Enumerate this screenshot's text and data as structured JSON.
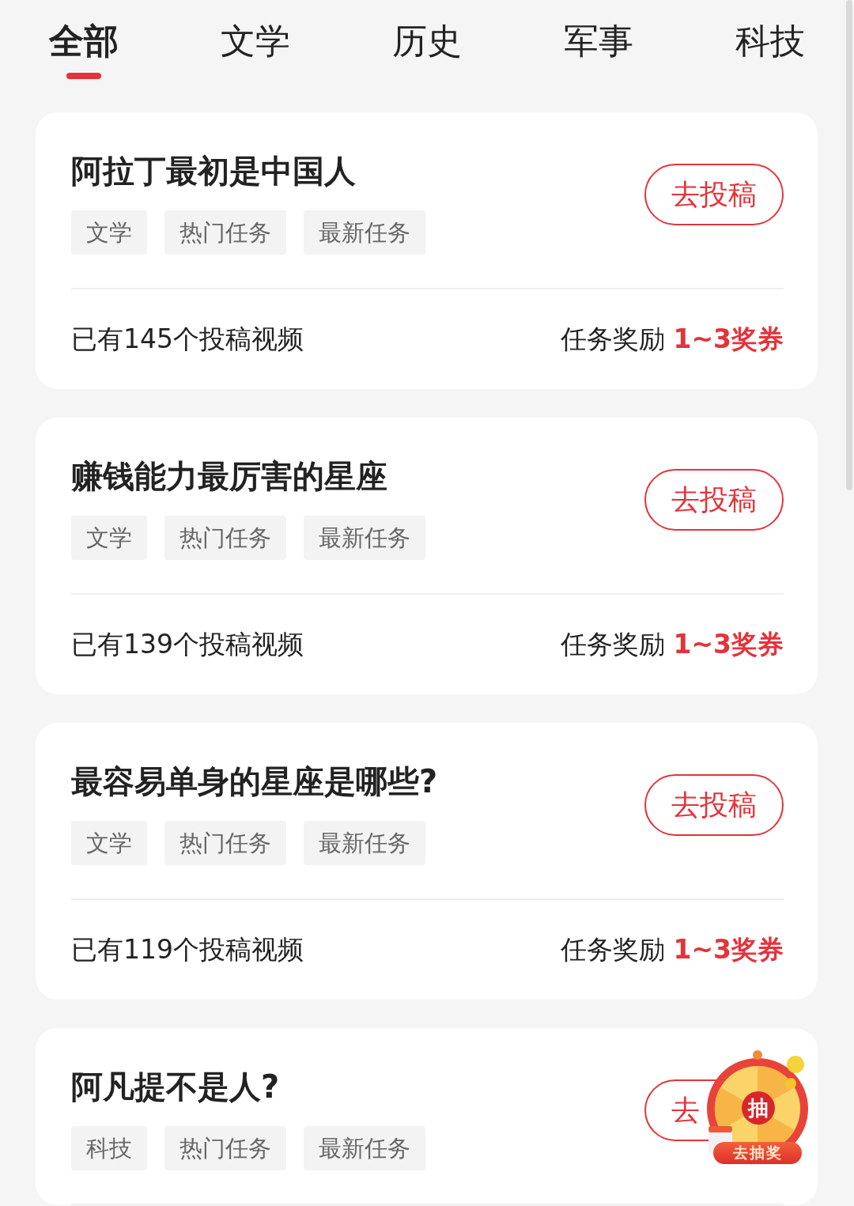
{
  "tabs": [
    {
      "label": "全部",
      "selected": true
    },
    {
      "label": "文学",
      "selected": false
    },
    {
      "label": "历史",
      "selected": false
    },
    {
      "label": "军事",
      "selected": false
    },
    {
      "label": "科技",
      "selected": false
    }
  ],
  "tasks": [
    {
      "title": "阿拉丁最初是中国人",
      "tags": [
        "文学",
        "热门任务",
        "最新任务"
      ],
      "button": "去投稿",
      "count": "已有145个投稿视频",
      "reward_label": "任务奖励",
      "reward_value": "1~3奖券"
    },
    {
      "title": "赚钱能力最厉害的星座",
      "tags": [
        "文学",
        "热门任务",
        "最新任务"
      ],
      "button": "去投稿",
      "count": "已有139个投稿视频",
      "reward_label": "任务奖励",
      "reward_value": "1~3奖券"
    },
    {
      "title": "最容易单身的星座是哪些?",
      "tags": [
        "文学",
        "热门任务",
        "最新任务"
      ],
      "button": "去投稿",
      "count": "已有119个投稿视频",
      "reward_label": "任务奖励",
      "reward_value": "1~3奖券"
    },
    {
      "title": "阿凡提不是人?",
      "tags": [
        "科技",
        "热门任务",
        "最新任务"
      ],
      "button": "去"
    }
  ],
  "lottery": {
    "badge": "抽",
    "label": "去抽奖"
  }
}
